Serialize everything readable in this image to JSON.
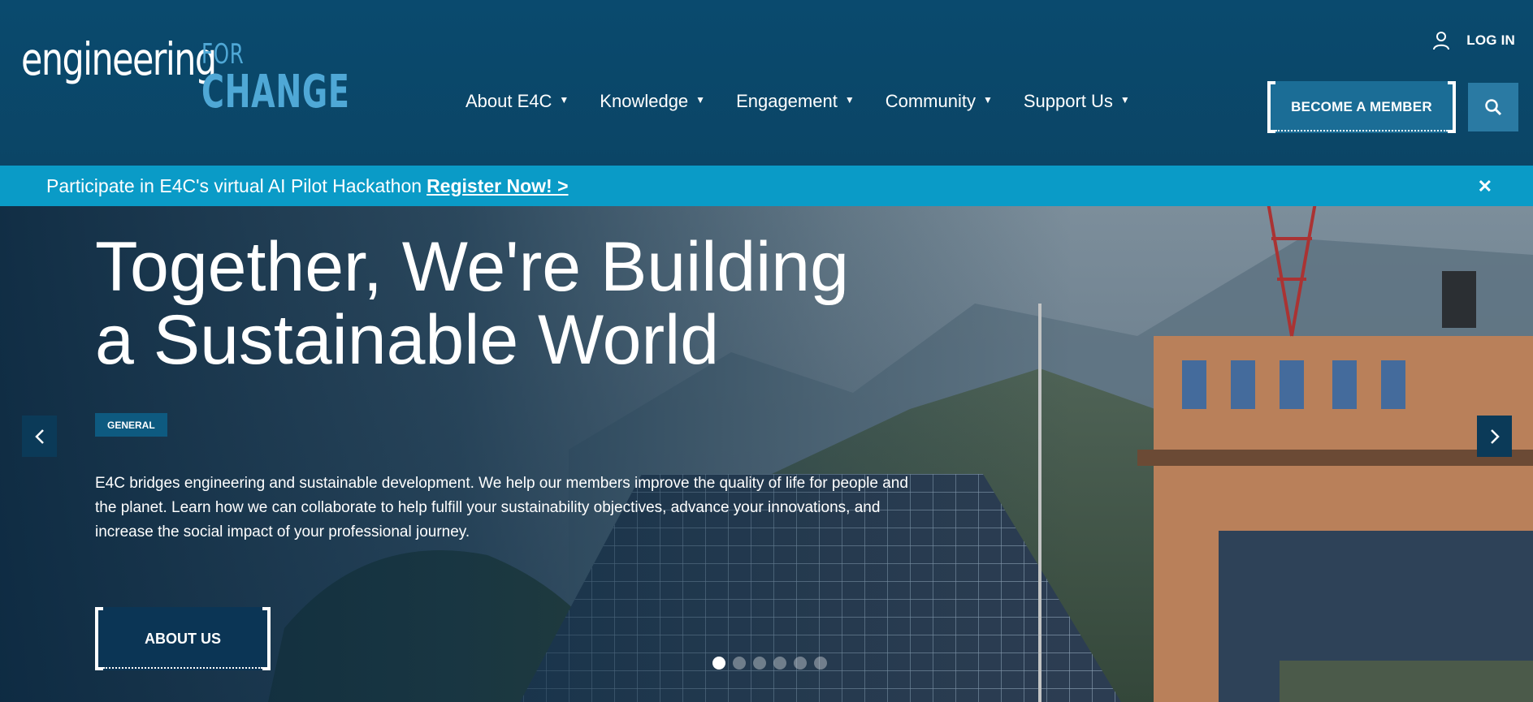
{
  "logo": {
    "main": "engineering",
    "for": "FOR",
    "change": "CHANGE"
  },
  "nav": [
    {
      "label": "About E4C"
    },
    {
      "label": "Knowledge"
    },
    {
      "label": "Engagement"
    },
    {
      "label": "Community"
    },
    {
      "label": "Support Us"
    }
  ],
  "header": {
    "login_label": "LOG IN",
    "become_member_label": "BECOME A MEMBER"
  },
  "banner": {
    "text": "Participate in E4C's virtual AI Pilot Hackathon",
    "link": "Register Now! >",
    "close": "✕"
  },
  "hero": {
    "title_line1": "Together, We're Building",
    "title_line2": "a Sustainable World",
    "tag": "GENERAL",
    "description": "E4C bridges engineering and sustainable development. We help our members improve the quality of life for people and the planet. Learn how we can collaborate to help fulfill your sustainability objectives, advance your innovations, and increase the social impact of your professional journey.",
    "cta": "ABOUT US",
    "slide_count": 6,
    "active_slide": 1
  },
  "colors": {
    "header_bg": "#0b4566",
    "banner_bg": "#0a9bc7",
    "accent": "#4fa8d6",
    "button_bg": "#1b6d96"
  },
  "icons": [
    "user-icon",
    "search-icon",
    "close-icon",
    "chevron-left-icon",
    "chevron-right-icon",
    "caret-down-icon"
  ]
}
